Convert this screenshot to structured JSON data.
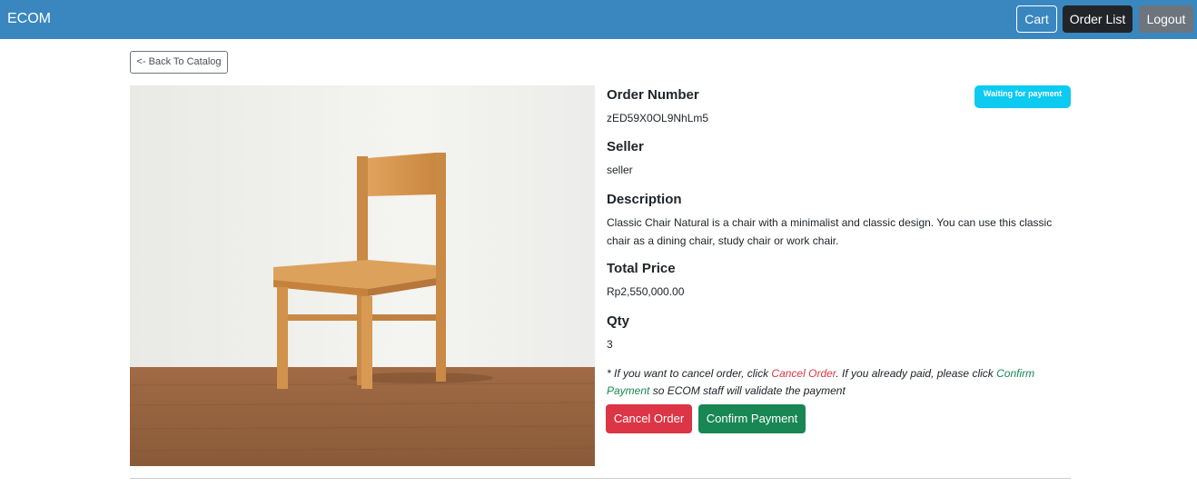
{
  "navbar": {
    "brand": "ECOM",
    "cart_label": "Cart",
    "order_list_label": "Order List",
    "logout_label": "Logout"
  },
  "back_label": "<- Back To Catalog",
  "status_badge": "Waiting for payment",
  "order": {
    "order_number_label": "Order Number",
    "order_number": "zED59X0OL9NhLm5",
    "seller_label": "Seller",
    "seller": "seller",
    "description_label": "Description",
    "description": "Classic Chair Natural is a chair with a minimalist and classic design. You can use this classic chair as a dining chair, study chair or work chair.",
    "total_price_label": "Total Price",
    "total_price": "Rp2,550,000.00",
    "qty_label": "Qty",
    "qty": "3"
  },
  "note": {
    "part1": "* If you want to cancel order, click ",
    "cancel_link": "Cancel Order",
    "part2": ". If you already paid, please click ",
    "confirm_link": "Confirm Payment",
    "part3": " so ECOM staff will validate the payment"
  },
  "actions": {
    "cancel_label": "Cancel Order",
    "confirm_label": "Confirm Payment"
  },
  "colors": {
    "navbar": "#3a87c0",
    "badge": "#0dcaf0",
    "danger": "#dc3545",
    "success": "#198754"
  },
  "icons": {
    "product_image": "wooden-chair-photo"
  }
}
